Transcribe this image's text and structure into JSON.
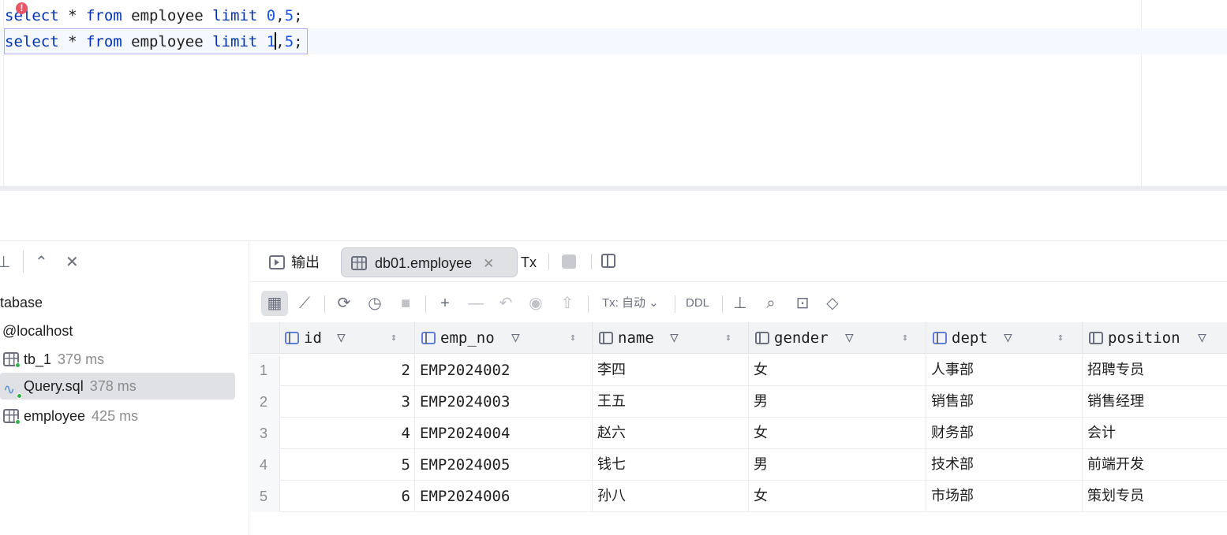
{
  "editor": {
    "line1": {
      "kw1": "select",
      "op": " * ",
      "kw2": "from",
      "table": " employee ",
      "kw3": "limit",
      "n1": "0",
      "sep": ",",
      "n2": "5",
      "end": ";"
    },
    "line2": {
      "kw1": "select",
      "op": " * ",
      "kw2": "from",
      "table": " employee ",
      "kw3": "limit",
      "n1": "1",
      "sep": ",",
      "n2": "5",
      "end": ";"
    }
  },
  "left_panel": {
    "items": [
      {
        "label": "tabase",
        "time": ""
      },
      {
        "label": "@localhost",
        "time": ""
      },
      {
        "label": "tb_1",
        "time": "379 ms"
      },
      {
        "label": "Query.sql",
        "time": "378 ms"
      },
      {
        "label": "employee",
        "time": "425 ms"
      }
    ]
  },
  "results": {
    "tabs": {
      "output": "输出",
      "active": "db01.employee",
      "tx": "Tx"
    },
    "toolbar": {
      "tx_mode": "Tx: 自动",
      "ddl": "DDL"
    },
    "columns": [
      "id",
      "emp_no",
      "name",
      "gender",
      "dept",
      "position"
    ],
    "rows": [
      {
        "rn": "1",
        "id": "2",
        "emp_no": "EMP2024002",
        "name": "李四",
        "gender": "女",
        "dept": "人事部",
        "position": "招聘专员"
      },
      {
        "rn": "2",
        "id": "3",
        "emp_no": "EMP2024003",
        "name": "王五",
        "gender": "男",
        "dept": "销售部",
        "position": "销售经理"
      },
      {
        "rn": "3",
        "id": "4",
        "emp_no": "EMP2024004",
        "name": "赵六",
        "gender": "女",
        "dept": "财务部",
        "position": "会计"
      },
      {
        "rn": "4",
        "id": "5",
        "emp_no": "EMP2024005",
        "name": "钱七",
        "gender": "男",
        "dept": "技术部",
        "position": "前端开发"
      },
      {
        "rn": "5",
        "id": "6",
        "emp_no": "EMP2024006",
        "name": "孙八",
        "gender": "女",
        "dept": "市场部",
        "position": "策划专员"
      }
    ]
  },
  "colors": {
    "keyword": "#0033b3",
    "number": "#1750eb",
    "accent": "#b5a8f0",
    "ok": "#2fb344",
    "error": "#e55765"
  }
}
